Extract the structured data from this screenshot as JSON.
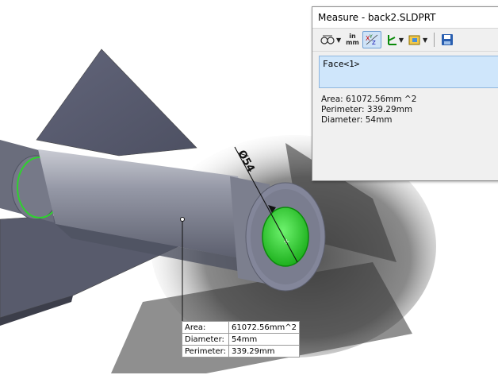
{
  "window": {
    "title": "Measure - back2.SLDPRT",
    "selection": "Face<1>",
    "results": [
      "Area: 61072.56mm ^2",
      "Perimeter: 339.29mm",
      "Diameter: 54mm"
    ],
    "toolbar": {
      "units_top": "in",
      "units_bottom": "mm"
    }
  },
  "viewport": {
    "dimension_label": "Ø54",
    "callout": [
      {
        "label": "Area:",
        "value": "61072.56mm^2"
      },
      {
        "label": "Diameter:",
        "value": "54mm"
      },
      {
        "label": "Perimeter:",
        "value": "339.29mm"
      }
    ]
  },
  "colors": {
    "part_body": "#5a5d6b",
    "highlight_green": "#22cc22",
    "selection_bg": "#cfe6fb"
  }
}
